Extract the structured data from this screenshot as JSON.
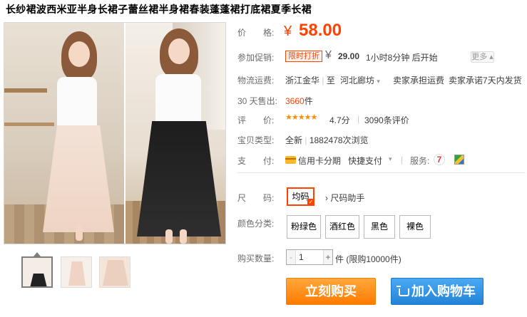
{
  "title": "长纱裙波西米亚半身长裙子蕾丝裙半身裙春装蓬蓬裙打底裙夏季长裙",
  "price": {
    "label": "价　　格:",
    "currency": "¥",
    "value": "58.00"
  },
  "promo": {
    "label": "参加促销:",
    "badge": "限时打折",
    "currency": "¥",
    "value": "29.00",
    "countdown": "1小时8分钟 后开始",
    "more": "更多"
  },
  "shipping": {
    "label": "物流运费:",
    "from": "浙江金华",
    "to_prefix": "至",
    "to": "河北廊坊",
    "fee": "卖家承担运费",
    "promise": "卖家承诺7天内发货"
  },
  "sales": {
    "label": "30 天售出:",
    "count": "3660",
    "unit": "件"
  },
  "review": {
    "label": "评　　价:",
    "stars": "★★★★★",
    "score": "4.7分",
    "count": "3090条评价"
  },
  "item_type": {
    "label": "宝贝类型:",
    "condition": "全新",
    "views": "1882478次浏览"
  },
  "payment": {
    "label": "支　　付:",
    "credit": "信用卡分期",
    "quick": "快捷支付",
    "service_label": "服务:",
    "service_7": "7"
  },
  "size": {
    "label": "尺　　码:",
    "option": "均码",
    "helper": "尺码助手"
  },
  "colors": {
    "label": "颜色分类:",
    "options": [
      "粉绿色",
      "酒红色",
      "黑色",
      "裸色"
    ]
  },
  "quantity": {
    "label": "购买数量:",
    "value": "1",
    "unit": "件 (限购10000件)"
  },
  "buttons": {
    "buy_now": "立刻购买",
    "add_cart": "加入购物车"
  },
  "colors_theme": {
    "accent": "#ff4200",
    "buy": "#ff7a00",
    "cart": "#2383d8"
  }
}
